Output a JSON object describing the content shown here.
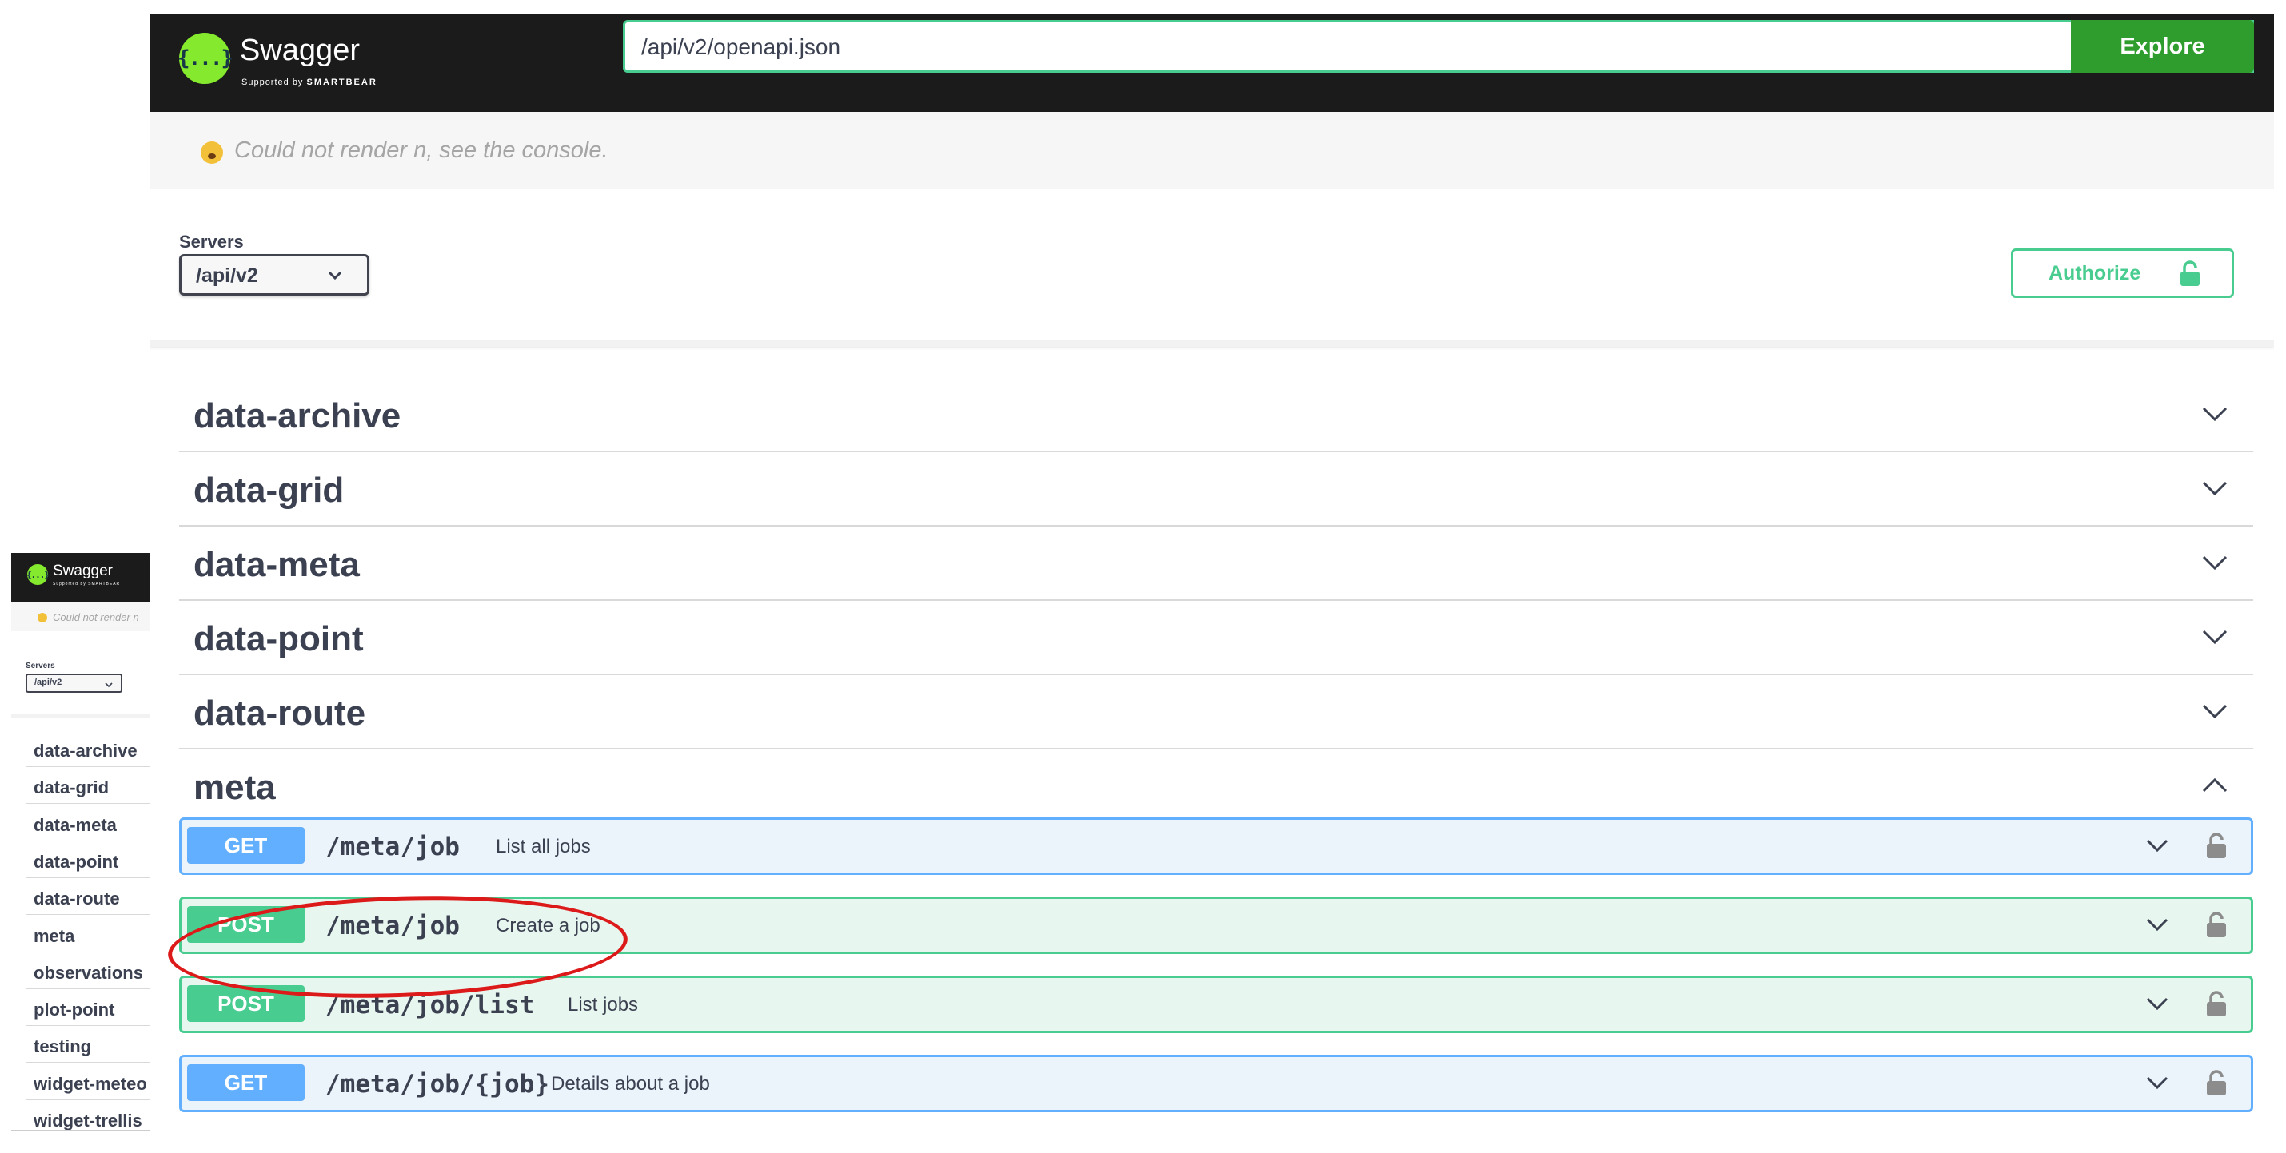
{
  "app": {
    "logo_text": "Swagger",
    "logo_glyph": "{...}",
    "logo_sub_prefix": "Supported by",
    "logo_sub_brand": "SMARTBEAR",
    "url_value": "/api/v2/openapi.json",
    "explore_label": "Explore"
  },
  "error": {
    "message": "Could not render n, see the console.",
    "icon": "screaming-face-emoji"
  },
  "servers": {
    "label": "Servers",
    "selected": "/api/v2"
  },
  "authorize": {
    "label": "Authorize",
    "icon": "unlocked-lock-icon"
  },
  "tags": [
    {
      "name": "data-archive",
      "expanded": false
    },
    {
      "name": "data-grid",
      "expanded": false
    },
    {
      "name": "data-meta",
      "expanded": false
    },
    {
      "name": "data-point",
      "expanded": false
    },
    {
      "name": "data-route",
      "expanded": false
    },
    {
      "name": "meta",
      "expanded": true
    }
  ],
  "operations": [
    {
      "method": "GET",
      "path": "/meta/job",
      "summary": "List all jobs"
    },
    {
      "method": "POST",
      "path": "/meta/job",
      "summary": "Create a job"
    },
    {
      "method": "POST",
      "path": "/meta/job/list",
      "summary": "List jobs"
    },
    {
      "method": "GET",
      "path": "/meta/job/{job}",
      "summary": "Details about a job"
    }
  ],
  "colors": {
    "get": "#61affe",
    "post": "#49cc90",
    "topbar": "#1b1b1b",
    "explore": "#2e9d2e",
    "highlight": "#dd1a1a"
  },
  "mini": {
    "logo_text": "Swagger",
    "logo_glyph": "{...}",
    "logo_sub": "Supported by SMARTBEAR",
    "error_text": "Could not render n",
    "servers_label": "Servers",
    "servers_selected": "/api/v2",
    "sidebar_items": [
      "data-archive",
      "data-grid",
      "data-meta",
      "data-point",
      "data-route",
      "meta",
      "observations",
      "plot-point",
      "testing",
      "widget-meteo",
      "widget-trellis"
    ]
  }
}
